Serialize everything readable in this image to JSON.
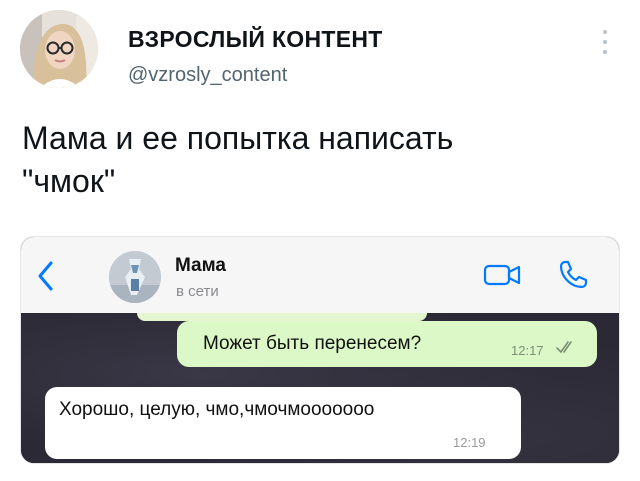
{
  "tweet": {
    "author_name": "ВЗРОСЛЫЙ КОНТЕНТ",
    "author_handle": "@vzrosly_content",
    "text": "Мама и ее попытка написать\n\"чмок\""
  },
  "chat": {
    "contact_name": "Мама",
    "contact_status": "в сети",
    "icons": {
      "back": "chevron-left-icon",
      "video": "video-camera-icon",
      "call": "phone-icon",
      "read_receipt": "double-check-icon"
    },
    "messages": [
      {
        "direction": "outgoing",
        "text": "Может быть перенесем?",
        "time": "12:17"
      },
      {
        "direction": "incoming",
        "text": "Хорошо, целую, чмо,чмочмоооооoo",
        "time": "12:19"
      }
    ]
  },
  "colors": {
    "accent": "#007aff",
    "outgoing_bubble": "#dcf8c6",
    "incoming_bubble": "#ffffff",
    "chat_background": "#2b2935",
    "handle_gray": "#536471"
  }
}
